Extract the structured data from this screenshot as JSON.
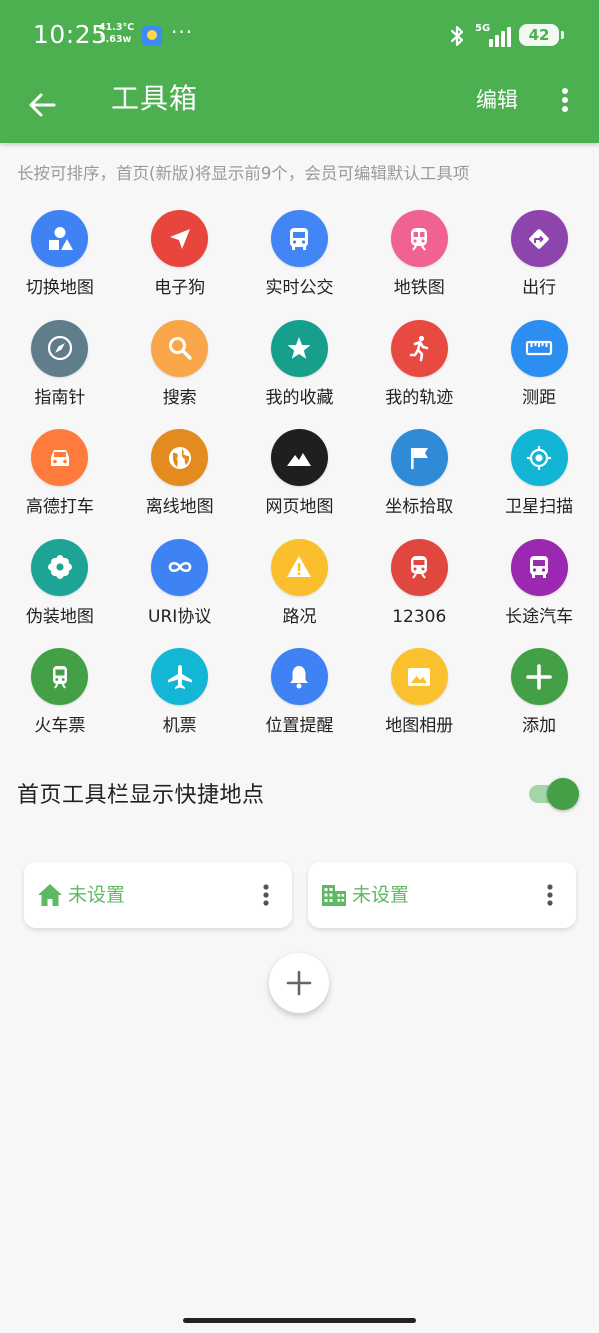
{
  "status_bar": {
    "time": "10:25",
    "net_temp": "41.3°C",
    "net_speed": "3.63w",
    "more": "···",
    "signal": "5G",
    "battery": "42"
  },
  "app_bar": {
    "title": "工具箱",
    "edit_label": "编辑"
  },
  "hint": "长按可排序，首页(新版)将显示前9个，会员可编辑默认工具项",
  "tools": [
    {
      "label": "切换地图",
      "color": "#3f82f4",
      "icon": "shapes-icon"
    },
    {
      "label": "电子狗",
      "color": "#e8453c",
      "icon": "navigation-arrow-icon"
    },
    {
      "label": "实时公交",
      "color": "#4285f4",
      "icon": "bus-icon"
    },
    {
      "label": "地铁图",
      "color": "#f06292",
      "icon": "subway-icon"
    },
    {
      "label": "出行",
      "color": "#8e44ad",
      "icon": "directions-icon"
    },
    {
      "label": "指南针",
      "color": "#607d8b",
      "icon": "compass-icon"
    },
    {
      "label": "搜索",
      "color": "#f9a64b",
      "icon": "search-icon"
    },
    {
      "label": "我的收藏",
      "color": "#16a08c",
      "icon": "star-icon"
    },
    {
      "label": "我的轨迹",
      "color": "#e84a42",
      "icon": "runner-icon"
    },
    {
      "label": "测距",
      "color": "#2b8ef0",
      "icon": "ruler-icon"
    },
    {
      "label": "高德打车",
      "color": "#ff7b3b",
      "icon": "car-icon"
    },
    {
      "label": "离线地图",
      "color": "#e38b1e",
      "icon": "globe-icon"
    },
    {
      "label": "网页地图",
      "color": "#1f1f1f",
      "icon": "mountain-icon"
    },
    {
      "label": "坐标拾取",
      "color": "#2f8ad8",
      "icon": "flag-icon"
    },
    {
      "label": "卫星扫描",
      "color": "#13b5d4",
      "icon": "crosshair-icon"
    },
    {
      "label": "伪装地图",
      "color": "#1ea494",
      "icon": "flower-icon"
    },
    {
      "label": "URI协议",
      "color": "#3f82f4",
      "icon": "infinity-icon"
    },
    {
      "label": "路况",
      "color": "#fbbf2e",
      "icon": "warning-icon"
    },
    {
      "label": "12306",
      "color": "#e0473f",
      "icon": "train-icon"
    },
    {
      "label": "长途汽车",
      "color": "#9c27b0",
      "icon": "coach-bus-icon"
    },
    {
      "label": "火车票",
      "color": "#43a047",
      "icon": "train-ticket-icon"
    },
    {
      "label": "机票",
      "color": "#14b6d6",
      "icon": "airplane-icon"
    },
    {
      "label": "位置提醒",
      "color": "#3f82f4",
      "icon": "bell-icon"
    },
    {
      "label": "地图相册",
      "color": "#fbc02d",
      "icon": "photo-icon"
    },
    {
      "label": "添加",
      "color": "#43a047",
      "icon": "plus-icon"
    }
  ],
  "quick_places": {
    "toggle_label": "首页工具栏显示快捷地点",
    "toggle_on": true,
    "home": {
      "label": "未设置",
      "icon": "home-icon"
    },
    "work": {
      "label": "未设置",
      "icon": "office-building-icon"
    }
  },
  "colors": {
    "primary": "#4caf50",
    "placeholder_text": "#5fb862",
    "hint_text": "#9a9a9a"
  }
}
